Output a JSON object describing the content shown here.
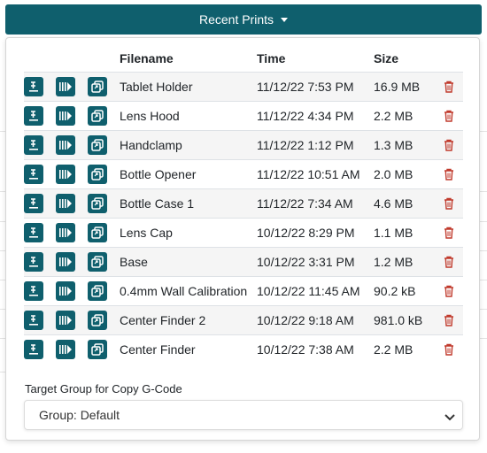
{
  "header": {
    "button_label": "Recent Prints",
    "caret_icon": "caret-down-icon"
  },
  "table": {
    "columns": [
      "",
      "",
      "",
      "Filename",
      "Time",
      "Size",
      ""
    ],
    "rows": [
      {
        "filename": "Tablet Holder",
        "time": "11/12/22 7:53 PM",
        "size": "16.9 MB"
      },
      {
        "filename": "Lens Hood",
        "time": "11/12/22 4:34 PM",
        "size": "2.2 MB"
      },
      {
        "filename": "Handclamp",
        "time": "11/12/22 1:12 PM",
        "size": "1.3 MB"
      },
      {
        "filename": "Bottle Opener",
        "time": "11/12/22 10:51 AM",
        "size": "2.0 MB"
      },
      {
        "filename": "Bottle Case 1",
        "time": "11/12/22 7:34 AM",
        "size": "4.6 MB"
      },
      {
        "filename": "Lens Cap",
        "time": "10/12/22 8:29 PM",
        "size": "1.1 MB"
      },
      {
        "filename": "Base",
        "time": "10/12/22 3:31 PM",
        "size": "1.2 MB"
      },
      {
        "filename": "0.4mm Wall Calibration",
        "time": "10/12/22 11:45 AM",
        "size": "90.2 kB"
      },
      {
        "filename": "Center Finder 2",
        "time": "10/12/22 9:18 AM",
        "size": "981.0 kB"
      },
      {
        "filename": "Center Finder",
        "time": "10/12/22 7:38 AM",
        "size": "2.2 MB"
      }
    ],
    "row_icons": [
      "load-file-icon",
      "print-icon",
      "copy-icon",
      "trash-icon"
    ]
  },
  "target_group": {
    "label": "Target Group for Copy G-Code",
    "selected": "Group: Default"
  },
  "colors": {
    "primary": "#0f5f6d",
    "delete": "#c0392b",
    "row_stripe": "#f5f5f5"
  }
}
